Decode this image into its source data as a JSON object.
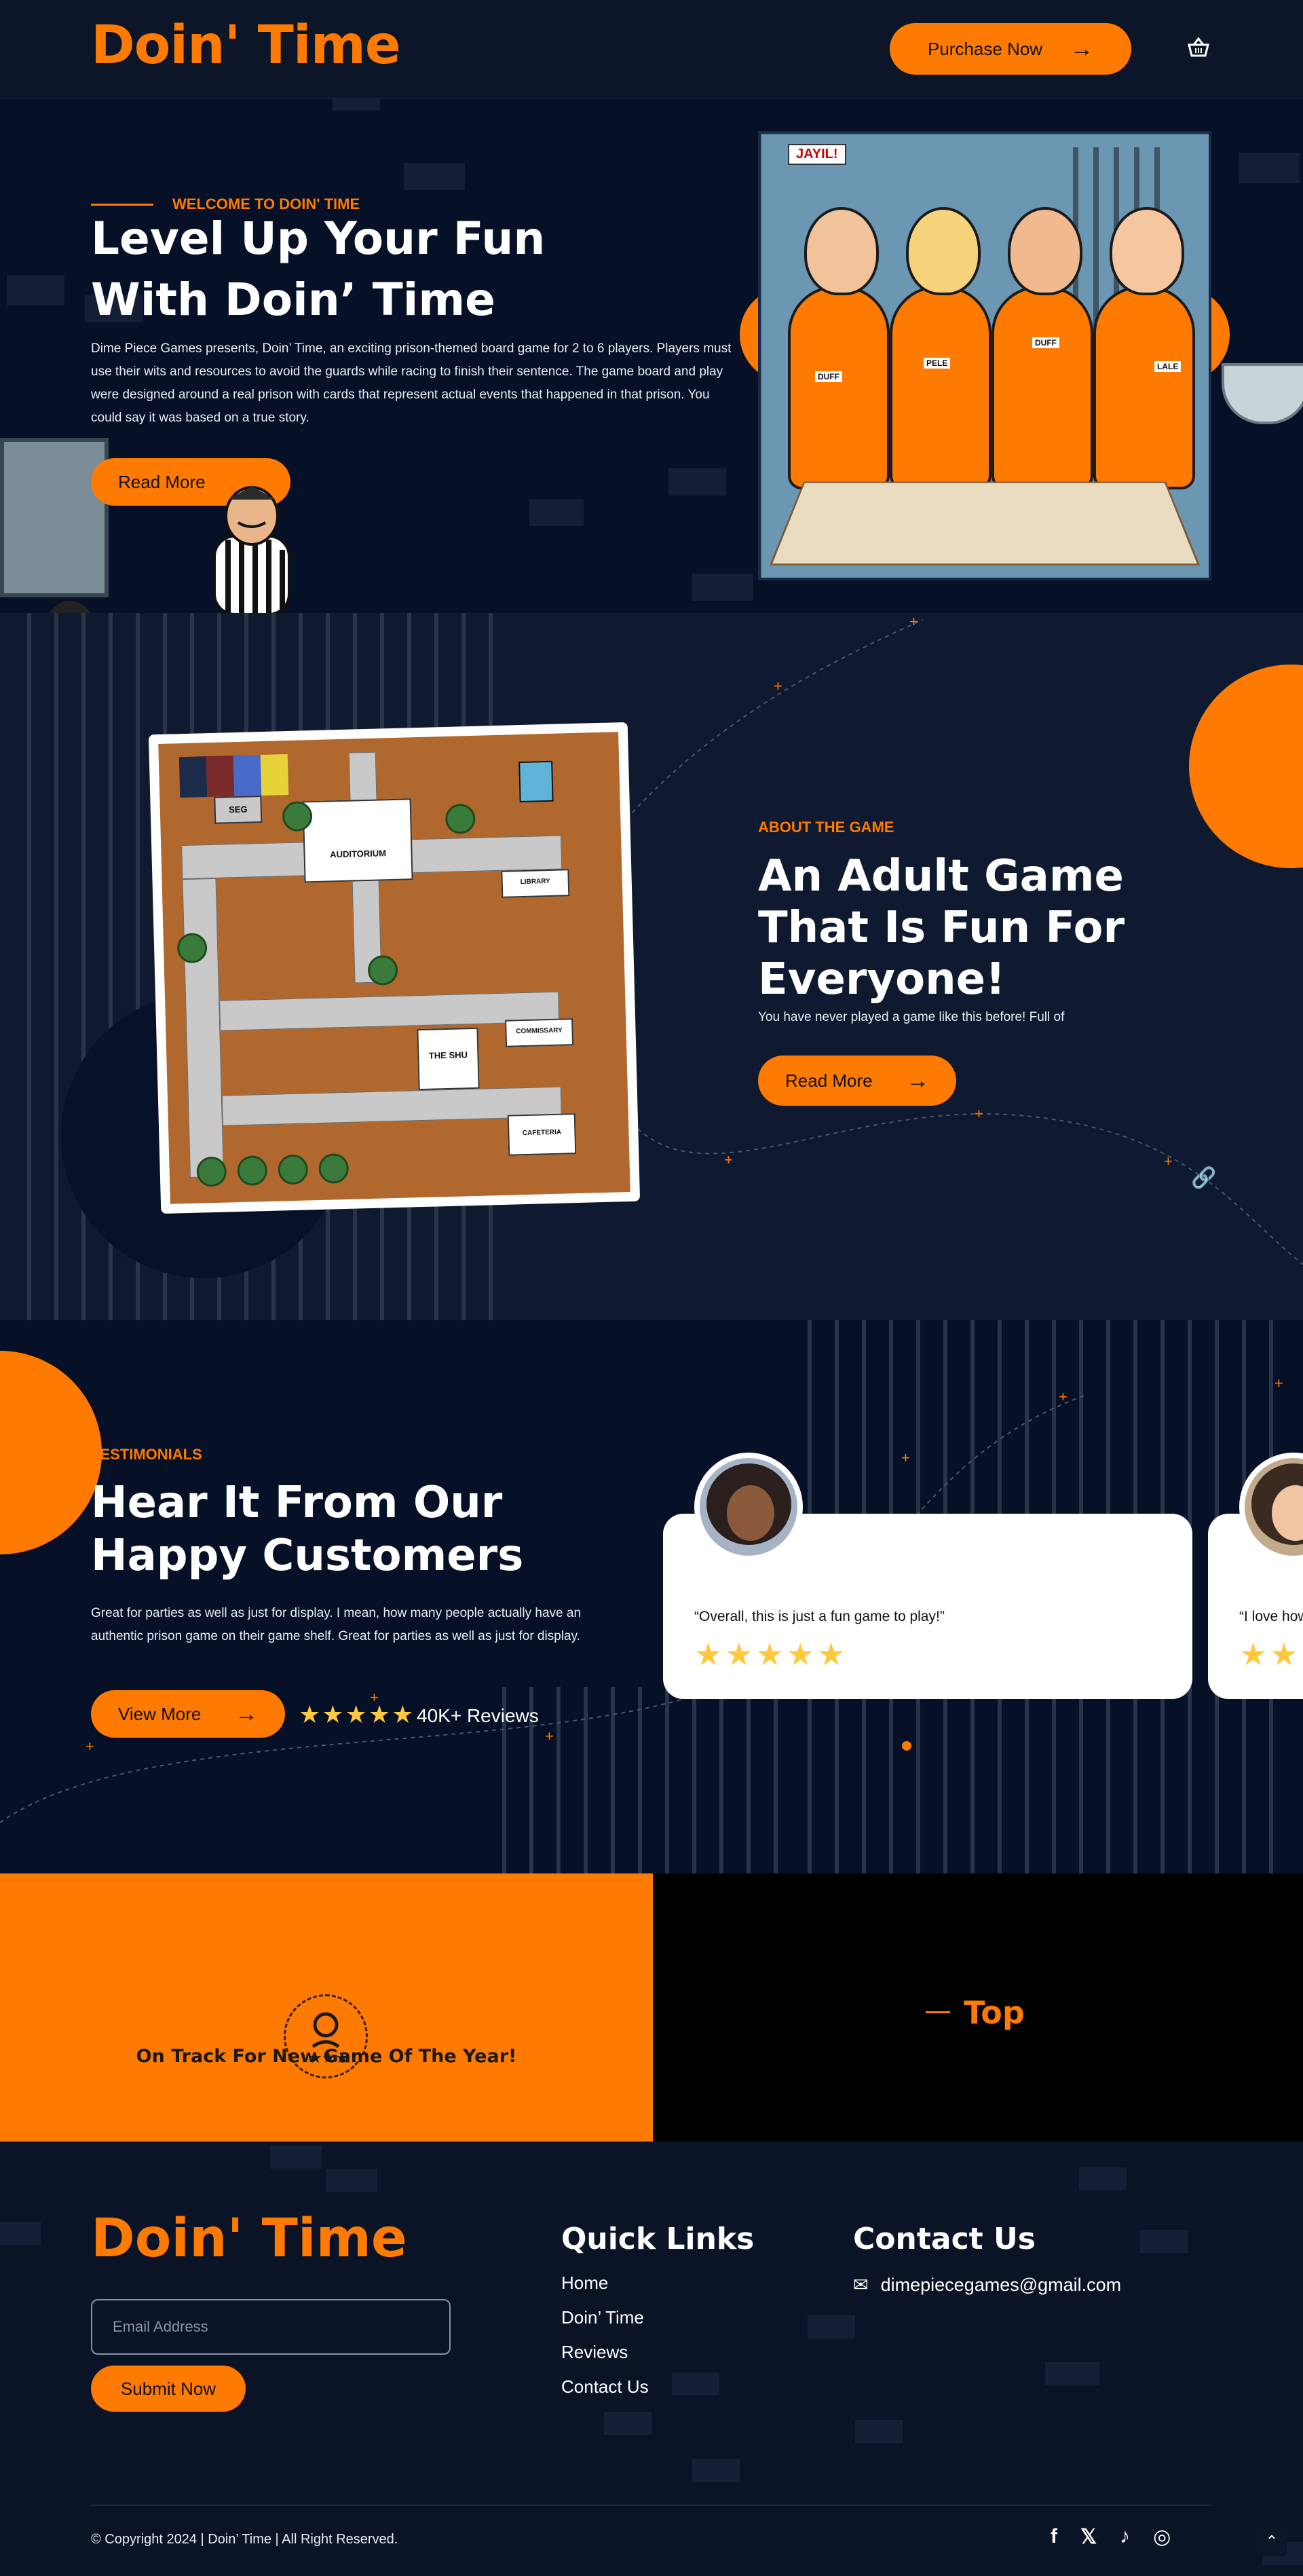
{
  "header": {
    "logo": "Doin' Time",
    "purchase_label": "Purchase Now",
    "cart_icon": "shopping-basket-icon"
  },
  "hero": {
    "eyebrow": "WELCOME TO DOIN' TIME",
    "title_line1": "Level Up Your Fun",
    "title_line2": "With Doin’ Time",
    "description": "Dime Piece Games presents, Doin’ Time, an exciting prison-themed board game for 2 to 6 players. Players must use their wits and resources to avoid the guards while racing to finish their sentence. The game board and play were designed around a real prison with cards that represent actual events that happened in that prison. You could say it was based on a true story.",
    "read_more_label": "Read More",
    "art_sign": "JAYIL!",
    "art_badges": [
      "DUFF",
      "PELE",
      "DUFF",
      "LALE"
    ]
  },
  "about": {
    "eyebrow": "ABOUT THE GAME",
    "title_line1": "An Adult Game",
    "title_line2": "That Is Fun For",
    "title_line3": "Everyone!",
    "description": "You have never played a game like this before! Full of",
    "read_more_label": "Read More",
    "board_rooms": [
      "AUDITORIUM",
      "THE SHU",
      "LIBRARY",
      "SEG",
      "COMMISSARY",
      "CAFETERIA"
    ]
  },
  "testimonials": {
    "eyebrow": "TESTIMONIALS",
    "title_line1": "Hear It From Our",
    "title_line2": "Happy Customers",
    "description": "Great for parties as well as just for display. I mean, how many people actually have an authentic prison game on their game shelf. Great for parties as well as just for display.",
    "view_more_label": "View More",
    "review_stars": "★★★★★",
    "review_count": "40K+ Reviews",
    "cards": [
      {
        "quote": "“Overall, this is just a fun game to play!”",
        "stars": "★★★★★"
      },
      {
        "quote": "“I love how",
        "stars": "★★"
      }
    ]
  },
  "award": {
    "text": "On Track For New Game Of The Year!",
    "top_label": "Top"
  },
  "footer": {
    "logo": "Doin' Time",
    "email_placeholder": "Email Address",
    "submit_label": "Submit Now",
    "quick_links_title": "Quick Links",
    "quick_links": [
      "Home",
      "Doin’ Time",
      "Reviews",
      "Contact Us"
    ],
    "contact_title": "Contact Us",
    "contact_email": "dimepiecegames@gmail.com",
    "copyright": "© Copyright 2024 | Doin’ Time | All Right Reserved.",
    "social_icons": [
      "facebook-icon",
      "x-icon",
      "tiktok-icon",
      "instagram-icon"
    ]
  },
  "colors": {
    "accent": "#ff7a00",
    "background": "#0b1426",
    "star": "#ffc83d"
  }
}
